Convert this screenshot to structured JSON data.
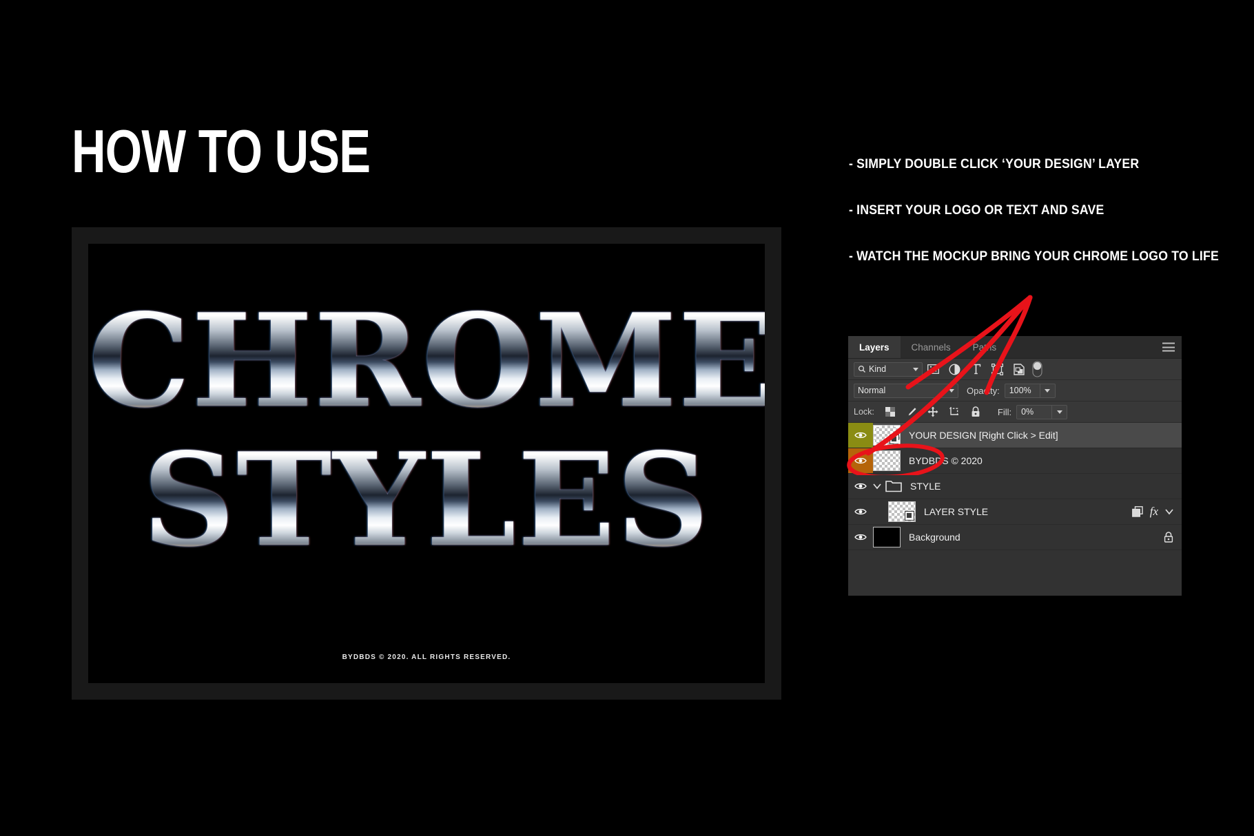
{
  "page": {
    "title": "HOW TO USE",
    "background_color": "#000000"
  },
  "artwork": {
    "line1": "CHROME",
    "line2": "STYLES",
    "credit": "BYDBDS © 2020. ALL RIGHTS RESERVED.",
    "frame_color": "#191919",
    "canvas_color": "#000000"
  },
  "instructions": [
    {
      "text": "- SIMPLY DOUBLE CLICK ‘YOUR DESIGN’ LAYER"
    },
    {
      "text": "- INSERT YOUR LOGO OR TEXT AND SAVE"
    },
    {
      "text": "- WATCH THE MOCKUP BRING YOUR CHROME LOGO TO LIFE"
    }
  ],
  "annotation": {
    "color": "#e8131a",
    "shape": "arrow-and-ellipse"
  },
  "layers_panel": {
    "tabs": [
      {
        "label": "Layers",
        "active": true
      },
      {
        "label": "Channels",
        "active": false
      },
      {
        "label": "Paths",
        "active": false
      }
    ],
    "menu_icon": "hamburger-menu-icon",
    "filter": {
      "kind_label": "Kind",
      "search_icon": "search-icon",
      "icons": [
        "pixel-layer-filter-icon",
        "adjustment-layer-filter-icon",
        "type-layer-filter-icon",
        "shape-layer-filter-icon",
        "smart-object-filter-icon"
      ],
      "toggle": "filter-toggle-switch"
    },
    "blend": {
      "mode": "Normal",
      "opacity_label": "Opacity:",
      "opacity_value": "100%"
    },
    "lock": {
      "label": "Lock:",
      "icons": [
        "lock-transparent-pixels-icon",
        "lock-image-pixels-icon",
        "lock-position-icon",
        "lock-artboard-nesting-icon",
        "lock-all-icon"
      ],
      "fill_label": "Fill:",
      "fill_value": "0%"
    },
    "layers": [
      {
        "name": "YOUR DESIGN [Right Click > Edit]",
        "visible": true,
        "selected": true,
        "color_label": "#8a8c13",
        "thumb": "smart-object-transparent",
        "indent": 0,
        "has_fx": false,
        "locked": false
      },
      {
        "name": "BYDBDS © 2020",
        "visible": true,
        "selected": false,
        "color_label": "#b5640a",
        "thumb": "transparent",
        "indent": 0,
        "has_fx": false,
        "locked": false
      },
      {
        "name": "STYLE",
        "visible": true,
        "selected": false,
        "color_label": "none",
        "thumb": "folder",
        "indent": 0,
        "has_fx": false,
        "locked": false
      },
      {
        "name": "LAYER STYLE",
        "visible": true,
        "selected": false,
        "color_label": "none",
        "thumb": "smart-object-transparent",
        "indent": 1,
        "has_fx": true,
        "fx_label": "fx",
        "locked": false
      },
      {
        "name": "Background",
        "visible": true,
        "selected": false,
        "color_label": "none",
        "thumb": "solid-black",
        "indent": 0,
        "has_fx": false,
        "locked": true
      }
    ]
  }
}
